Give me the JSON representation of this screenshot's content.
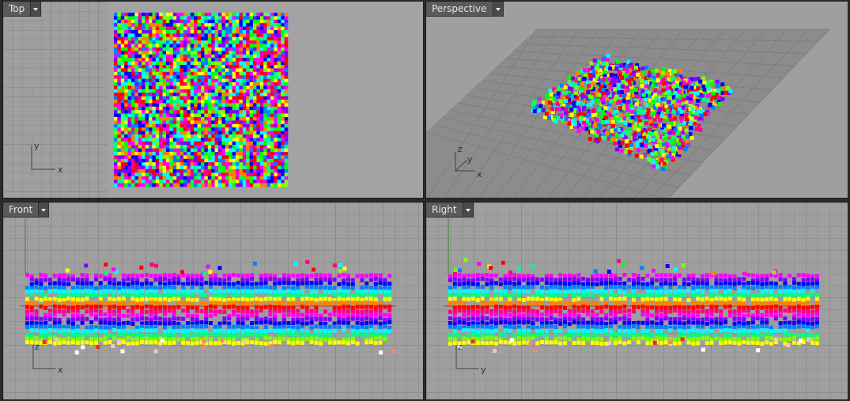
{
  "viewports": {
    "top": {
      "title": "Top"
    },
    "perspective": {
      "title": "Perspective"
    },
    "front": {
      "title": "Front"
    },
    "right": {
      "title": "Right"
    }
  },
  "axis_labels": {
    "x": "x",
    "y": "y",
    "z": "z"
  },
  "colors": {
    "viewport_bg": "#9f9f9f",
    "grid_line": "#8c8c8c",
    "x_axis": "#c03030",
    "z_axis": "#2a8a2a",
    "point_palette": [
      "#ff0000",
      "#ff8000",
      "#ffff00",
      "#80ff00",
      "#00ff00",
      "#00ff80",
      "#00ffff",
      "#0080ff",
      "#0000ff",
      "#8000ff",
      "#ff00ff",
      "#ff0080"
    ]
  }
}
